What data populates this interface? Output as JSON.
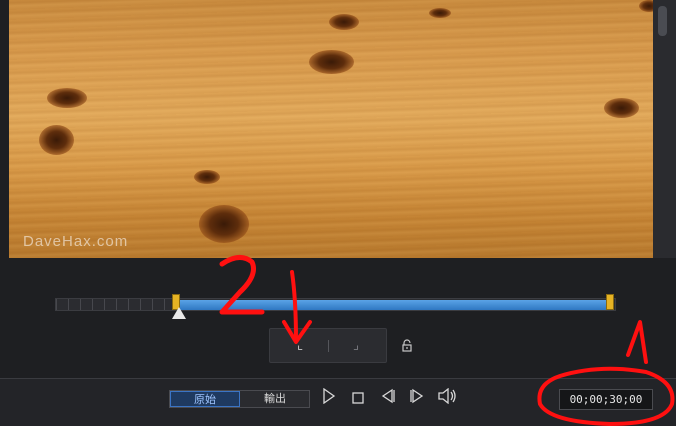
{
  "preview": {
    "watermark": "DaveHax.com"
  },
  "controls": {
    "original_label": "原始",
    "output_label": "輸出",
    "play_icon": "▷",
    "stop_icon": "□",
    "prev_frame_icon": "◁|",
    "next_frame_icon": "|▷",
    "volume_icon": "🔊",
    "timecode": "00;00;30;00"
  },
  "marks": {
    "mark_in_icon": "⌞",
    "mark_out_icon": "⌟",
    "lock_icon": "🔓"
  },
  "annotations": {
    "label_1": "1",
    "label_2": "2",
    "color": "#ff1010"
  }
}
